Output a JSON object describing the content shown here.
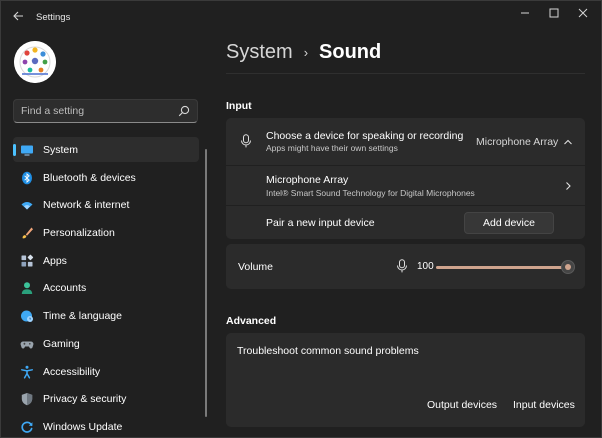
{
  "app": {
    "title": "Settings"
  },
  "search": {
    "placeholder": "Find a setting"
  },
  "sidebar": {
    "items": [
      {
        "label": "System",
        "icon": "monitor-icon",
        "active": true
      },
      {
        "label": "Bluetooth & devices",
        "icon": "bluetooth-icon"
      },
      {
        "label": "Network & internet",
        "icon": "wifi-icon"
      },
      {
        "label": "Personalization",
        "icon": "brush-icon"
      },
      {
        "label": "Apps",
        "icon": "apps-icon"
      },
      {
        "label": "Accounts",
        "icon": "person-icon"
      },
      {
        "label": "Time & language",
        "icon": "globe-clock-icon"
      },
      {
        "label": "Gaming",
        "icon": "gamepad-icon"
      },
      {
        "label": "Accessibility",
        "icon": "accessibility-icon"
      },
      {
        "label": "Privacy & security",
        "icon": "shield-icon"
      },
      {
        "label": "Windows Update",
        "icon": "update-icon"
      }
    ]
  },
  "breadcrumb": {
    "parent": "System",
    "separator": "›",
    "current": "Sound"
  },
  "input": {
    "section_title": "Input",
    "device_chooser": {
      "title": "Choose a device for speaking or recording",
      "subtitle": "Apps might have their own settings",
      "selected": "Microphone Array"
    },
    "device": {
      "name": "Microphone Array",
      "description": "Intel® Smart Sound Technology for Digital Microphones"
    },
    "pair": {
      "label": "Pair a new input device",
      "button": "Add device"
    },
    "volume": {
      "label": "Volume",
      "value": "100",
      "level": 1.0
    }
  },
  "advanced": {
    "section_title": "Advanced",
    "troubleshoot": {
      "title": "Troubleshoot common sound problems",
      "output_link": "Output devices",
      "input_link": "Input devices"
    }
  },
  "colors": {
    "accent": "#4cc2ff",
    "slider": "#cfa48e",
    "background": "#202020",
    "card": "#2b2b2b"
  }
}
